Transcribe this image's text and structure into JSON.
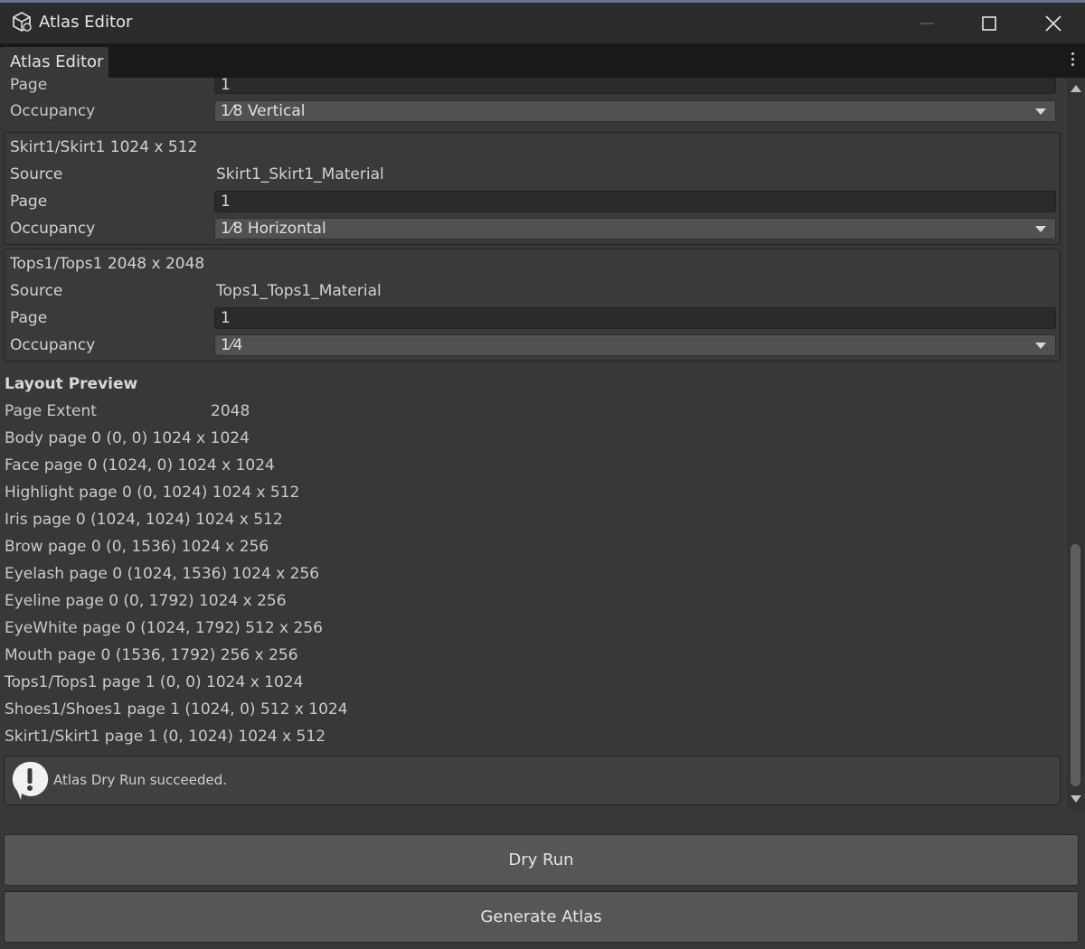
{
  "window": {
    "title": "Atlas Editor",
    "icons": {
      "app": "unity-cube-icon",
      "minimize": "minimize-icon",
      "maximize": "maximize-icon",
      "close": "close-icon"
    }
  },
  "tab": {
    "label": "Atlas Editor",
    "menu_icon": "kebab-menu-icon"
  },
  "partial_entry": {
    "page_label": "Page",
    "page_value": "1",
    "occupancy_label": "Occupancy",
    "occupancy_value": "1⁄8 Vertical"
  },
  "entries": [
    {
      "header": "Skirt1/Skirt1  1024 x 512",
      "source_label": "Source",
      "source_value": "Skirt1_Skirt1_Material",
      "page_label": "Page",
      "page_value": "1",
      "occupancy_label": "Occupancy",
      "occupancy_value": "1⁄8 Horizontal"
    },
    {
      "header": "Tops1/Tops1  2048 x 2048",
      "source_label": "Source",
      "source_value": "Tops1_Tops1_Material",
      "page_label": "Page",
      "page_value": "1",
      "occupancy_label": "Occupancy",
      "occupancy_value": "1⁄4"
    }
  ],
  "layout_preview": {
    "title": "Layout Preview",
    "page_extent_label": "Page Extent",
    "page_extent_value": "2048",
    "lines": [
      "Body  page 0  (0, 0) 1024 x 1024",
      "Face  page 0  (1024, 0) 1024 x 1024",
      "Highlight  page 0  (0, 1024) 1024 x 512",
      "Iris  page 0  (1024, 1024) 1024 x 512",
      "Brow  page 0  (0, 1536) 1024 x 256",
      "Eyelash  page 0  (1024, 1536) 1024 x 256",
      "Eyeline  page 0  (0, 1792) 1024 x 256",
      "EyeWhite  page 0  (1024, 1792) 512 x 256",
      "Mouth  page 0  (1536, 1792) 256 x 256",
      "Tops1/Tops1  page 1  (0, 0) 1024 x 1024",
      "Shoes1/Shoes1  page 1  (1024, 0) 512 x 1024",
      "Skirt1/Skirt1  page 1  (0, 1024) 1024 x 512"
    ]
  },
  "help": {
    "icon": "info-icon",
    "message": "Atlas Dry Run succeeded."
  },
  "buttons": {
    "dry_run": "Dry Run",
    "generate": "Generate Atlas"
  }
}
